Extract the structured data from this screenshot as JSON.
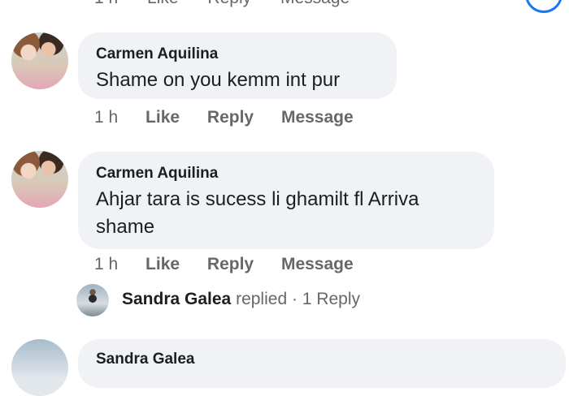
{
  "top_row": {
    "time": "1 h",
    "like": "Like",
    "reply": "Reply",
    "message": "Message"
  },
  "comments": [
    {
      "author": "Carmen Aquilina",
      "text": "Shame on you kemm int pur",
      "time": "1 h",
      "like": "Like",
      "reply": "Reply",
      "message": "Message"
    },
    {
      "author": "Carmen Aquilina",
      "text": "Ahjar tara is sucess li ghamilt fl Arriva shame",
      "time": "1 h",
      "like": "Like",
      "reply": "Reply",
      "message": "Message",
      "replies": {
        "name": "Sandra Galea",
        "verb": "replied",
        "separator": "·",
        "count": "1 Reply"
      }
    }
  ],
  "bottom_comment": {
    "author": "Sandra Galea"
  },
  "colors": {
    "bubble": "#f0f2f5",
    "secondary_text": "#65676b",
    "accent": "#1877f2"
  }
}
